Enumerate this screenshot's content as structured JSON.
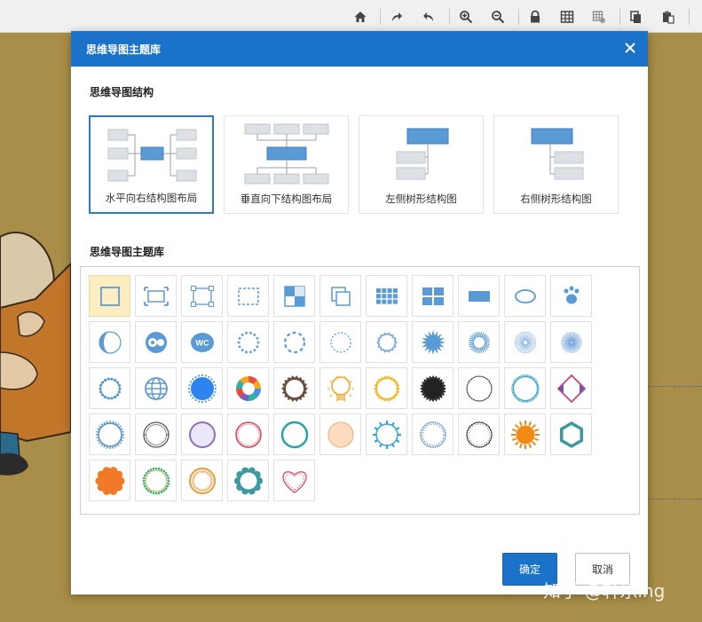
{
  "dialog": {
    "title": "思维导图主题库",
    "structure_section_title": "思维导图结构",
    "theme_section_title": "思维导图主题库",
    "ok_label": "确定",
    "cancel_label": "取消"
  },
  "structures": [
    {
      "label": "水平向右结构图布局",
      "selected": true
    },
    {
      "label": "垂直向下结构图布局",
      "selected": false
    },
    {
      "label": "左侧树形结构图",
      "selected": false
    },
    {
      "label": "右侧树形结构图",
      "selected": false
    }
  ],
  "themes": [
    {
      "name": "square-outline-icon"
    },
    {
      "name": "frame-corners-icon"
    },
    {
      "name": "square-handles-icon"
    },
    {
      "name": "dashed-square-icon"
    },
    {
      "name": "checker-square-icon"
    },
    {
      "name": "stacked-squares-icon"
    },
    {
      "name": "grid-squares-icon"
    },
    {
      "name": "four-squares-icon"
    },
    {
      "name": "rectangle-icon"
    },
    {
      "name": "ellipse-icon"
    },
    {
      "name": "paw-icon"
    },
    {
      "name": "half-moon-icon"
    },
    {
      "name": "yin-yang-icon"
    },
    {
      "name": "wc-badge-icon"
    },
    {
      "name": "dotted-circle-icon"
    },
    {
      "name": "dashed-circle-icon"
    },
    {
      "name": "dotted-circle-small-icon"
    },
    {
      "name": "scalloped-circle-icon"
    },
    {
      "name": "starburst-icon"
    },
    {
      "name": "sunburst-icon"
    },
    {
      "name": "radial-lines-icon"
    },
    {
      "name": "fine-rays-icon"
    },
    {
      "name": "dotted-ring-icon"
    },
    {
      "name": "globe-icon"
    },
    {
      "name": "blue-dot-circle-icon"
    },
    {
      "name": "aperture-icon"
    },
    {
      "name": "brown-gear-icon"
    },
    {
      "name": "lightbulb-icon"
    },
    {
      "name": "yellow-gear-icon"
    },
    {
      "name": "black-seal-icon"
    },
    {
      "name": "black-ring-icon"
    },
    {
      "name": "teal-dotted-ring-icon"
    },
    {
      "name": "diamond-ribbon-icon"
    },
    {
      "name": "blue-dot-ring-icon"
    },
    {
      "name": "double-ring-icon"
    },
    {
      "name": "purple-circle-icon"
    },
    {
      "name": "red-ring-icon"
    },
    {
      "name": "teal-ring-icon"
    },
    {
      "name": "peach-circle-icon"
    },
    {
      "name": "sun-ring-icon"
    },
    {
      "name": "blue-dotted-ring-icon"
    },
    {
      "name": "black-dotted-ring-icon"
    },
    {
      "name": "orange-sun-icon"
    },
    {
      "name": "teal-hexagon-icon"
    },
    {
      "name": "orange-flower-icon"
    },
    {
      "name": "green-dot-ring-icon"
    },
    {
      "name": "orange-double-ring-icon"
    },
    {
      "name": "teal-scallop-icon"
    },
    {
      "name": "heart-icon"
    }
  ],
  "toolbar": {
    "icons": [
      "home-icon",
      "redo-icon",
      "undo-icon",
      "zoom-in-icon",
      "zoom-out-icon",
      "lock-icon",
      "table-icon",
      "grid-settings-icon",
      "copy-icon",
      "paste-icon"
    ]
  },
  "watermark": {
    "text": "知乎 @轩乐ing"
  }
}
